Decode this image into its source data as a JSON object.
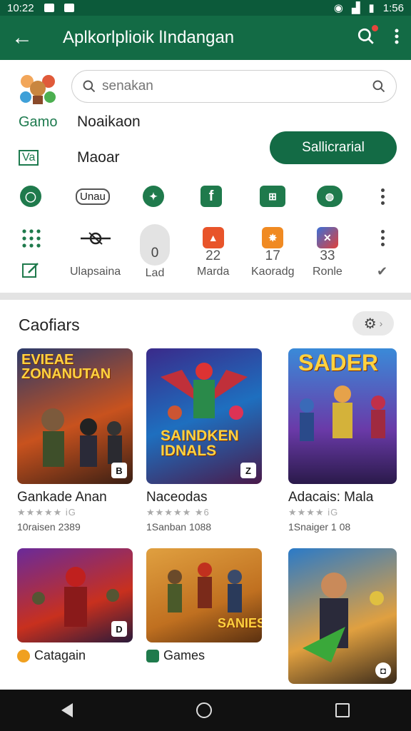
{
  "status": {
    "time": "10:22",
    "right_time": "1:56"
  },
  "appbar": {
    "title": "Aplkorlplioik lIndangan"
  },
  "search": {
    "value": "",
    "placeholder": "senakan"
  },
  "rows": [
    {
      "label": "Gamo",
      "text": "Noaikaon"
    },
    {
      "label": "Va",
      "text": "Maoar"
    }
  ],
  "cta": {
    "label": "Sallicrarial"
  },
  "iconrow1": [
    {
      "name": "green-circle-icon",
      "color": "#1f7a4c",
      "text": ""
    },
    {
      "name": "unao-pill-icon",
      "color": "#ffffff",
      "text": "Unau"
    },
    {
      "name": "puzzle-icon",
      "color": "#1f7a4c",
      "text": ""
    },
    {
      "name": "facebook-icon",
      "color": "#1f7a4c",
      "text": "f"
    },
    {
      "name": "network-icon",
      "color": "#1f7a4c",
      "text": ""
    },
    {
      "name": "chat-icon",
      "color": "#1f7a4c",
      "text": ""
    }
  ],
  "iconrow2": [
    {
      "label": "Ulapsaina",
      "num": ""
    },
    {
      "label": "Lad",
      "num": "0"
    },
    {
      "label": "Marda",
      "num": "22"
    },
    {
      "label": "Kaoradg",
      "num": "17"
    },
    {
      "label": "Ronle",
      "num": "33"
    }
  ],
  "section": {
    "title": "Caofiars"
  },
  "cards": [
    {
      "title_art": "EVIEAE ZONANUTAN",
      "name": "Gankade Anan",
      "stars": "★★★★★ iG",
      "meta": "10raisen 2389"
    },
    {
      "title_art": "SAINDKEN IDNALS",
      "name": "Naceodas",
      "stars": "★★★★★ ★6",
      "meta": "1Sanban 1088"
    },
    {
      "title_art": "SADER",
      "name": "Adacais: Mala",
      "stars": "★★★★ iG",
      "meta": "1Snaiger 1 08"
    }
  ],
  "cards2": [
    {
      "name": "Catagain",
      "color": "#f0a020"
    },
    {
      "name": "Games",
      "color": "#1f7a4c"
    }
  ],
  "cards2_art": {
    "saniels": "SANIES"
  }
}
